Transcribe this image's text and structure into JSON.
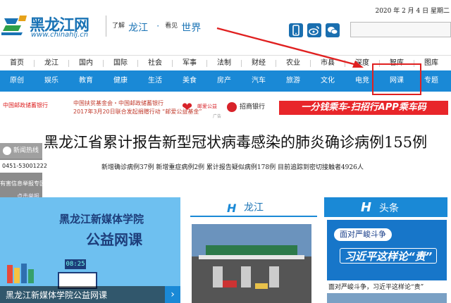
{
  "header": {
    "logo_cn": "黑龙江网",
    "logo_url": "www.chinahlj.cn",
    "slogan": {
      "pre1": "了解",
      "region": "龙江",
      "dot": "·",
      "pre2": "看见",
      "world": "世界"
    },
    "date": "2020 年 2 月 4 日 星期二",
    "social_icons": [
      "mobile-icon",
      "weibo-icon",
      "wechat-icon"
    ],
    "search_placeholder": ""
  },
  "nav_primary": [
    "首页",
    "龙江",
    "国内",
    "国际",
    "社会",
    "军事",
    "法制",
    "财经",
    "农业",
    "市县",
    "深度",
    "智库",
    "图库"
  ],
  "nav_secondary": [
    "原创",
    "娱乐",
    "教育",
    "健康",
    "生活",
    "美食",
    "房产",
    "汽车",
    "旅游",
    "文化",
    "电竞",
    "网课",
    "专题"
  ],
  "highlight": {
    "nav_item": "网课",
    "box_color": "#e02020"
  },
  "banner": {
    "left_org": "中国邮政储蓄银行",
    "left_line1": "中国扶贫基金会・中国邮政储蓄银行",
    "left_line2": "2017年3月20日联合发起捐赠行动 “邮爱公益基金”",
    "left_badge": "邮爱公益",
    "ad_tag": "广告",
    "right_bank": "招商银行",
    "right_promo": "一分钱乘车-扫招行APP乘车码"
  },
  "headline": "黑龙江省累计报告新型冠状病毒感染的肺炎确诊病例155例",
  "subline": "新增确诊病例37例  新增重症病例2例  累计报告疑似病例178例  目前追踪到密切接触者4926人",
  "hotline": {
    "title": "新闻热线",
    "number": "0451-53001222",
    "report": "有害信息举报专区",
    "click": "点击举报"
  },
  "promo_card": {
    "title1": "黑龙江新媒体学院",
    "title2": "公益网课",
    "clock": "08:25",
    "caption": "黑龙江新媒体学院公益网课",
    "next_icon": "›"
  },
  "section_longjiang": {
    "icon": "H",
    "title": "龙江"
  },
  "section_toutiao": {
    "icon": "H",
    "title": "头条",
    "pill1": "面对严峻斗争",
    "pill2": "习近平这样论“责”",
    "story": "面对严峻斗争，习近平这样论“责”"
  },
  "colors": {
    "brand_blue": "#1a89d6",
    "headline_text": "#111111",
    "alert_red": "#e02020"
  }
}
